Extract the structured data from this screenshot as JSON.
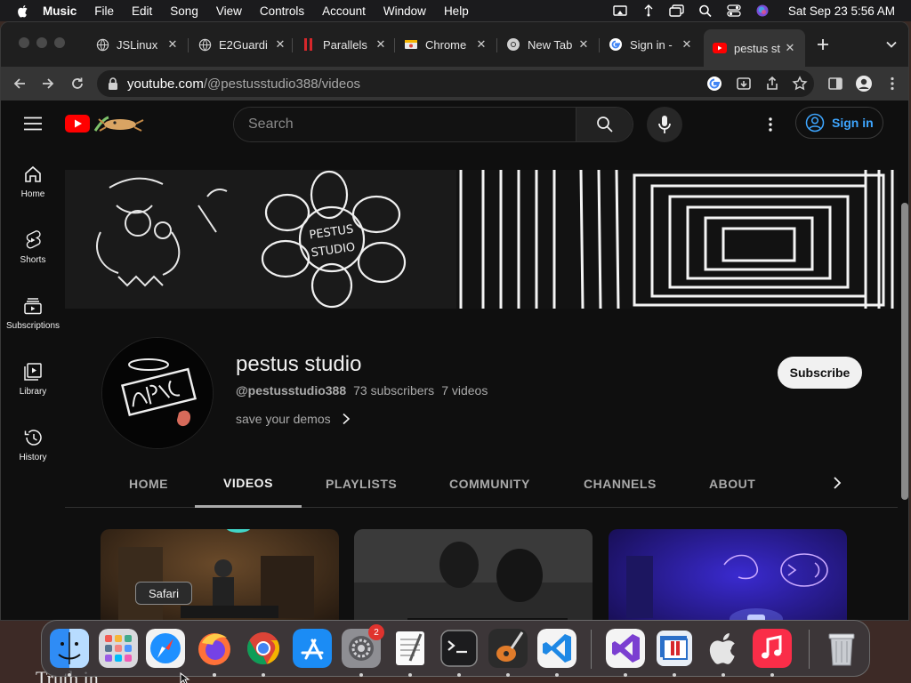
{
  "menubar": {
    "app_name": "Music",
    "items": [
      "File",
      "Edit",
      "Song",
      "View",
      "Controls",
      "Account",
      "Window",
      "Help"
    ],
    "datetime": "Sat Sep 23  5:56 AM"
  },
  "browser": {
    "tabs": [
      {
        "title": "JSLinux",
        "icon": "globe-icon"
      },
      {
        "title": "E2Guardi",
        "icon": "globe-icon"
      },
      {
        "title": "Parallels",
        "icon": "parallels-icon"
      },
      {
        "title": "Chrome",
        "icon": "chrome-warning-icon"
      },
      {
        "title": "New Tab",
        "icon": "chrome-icon"
      },
      {
        "title": "Sign in -",
        "icon": "google-icon"
      },
      {
        "title": "pestus st",
        "icon": "youtube-icon"
      }
    ],
    "url_host": "youtube.com",
    "url_path": "/@pestusstudio388/videos"
  },
  "youtube": {
    "search_placeholder": "Search",
    "signin_label": "Sign in",
    "sidebar": [
      {
        "label": "Home",
        "icon": "home-icon"
      },
      {
        "label": "Shorts",
        "icon": "shorts-icon"
      },
      {
        "label": "Subscriptions",
        "icon": "subscriptions-icon"
      },
      {
        "label": "Library",
        "icon": "library-icon"
      },
      {
        "label": "History",
        "icon": "history-icon"
      }
    ],
    "channel": {
      "name": "pestus studio",
      "handle": "@pestusstudio388",
      "subscribers": "73 subscribers",
      "videos": "7 videos",
      "description": "save your demos",
      "subscribe_label": "Subscribe"
    },
    "tabs": [
      "HOME",
      "VIDEOS",
      "PLAYLISTS",
      "COMMUNITY",
      "CHANNELS",
      "ABOUT"
    ],
    "active_tab": "VIDEOS"
  },
  "dock": {
    "tooltip": "Safari",
    "settings_badge": "2"
  },
  "background_text": "Truth in"
}
